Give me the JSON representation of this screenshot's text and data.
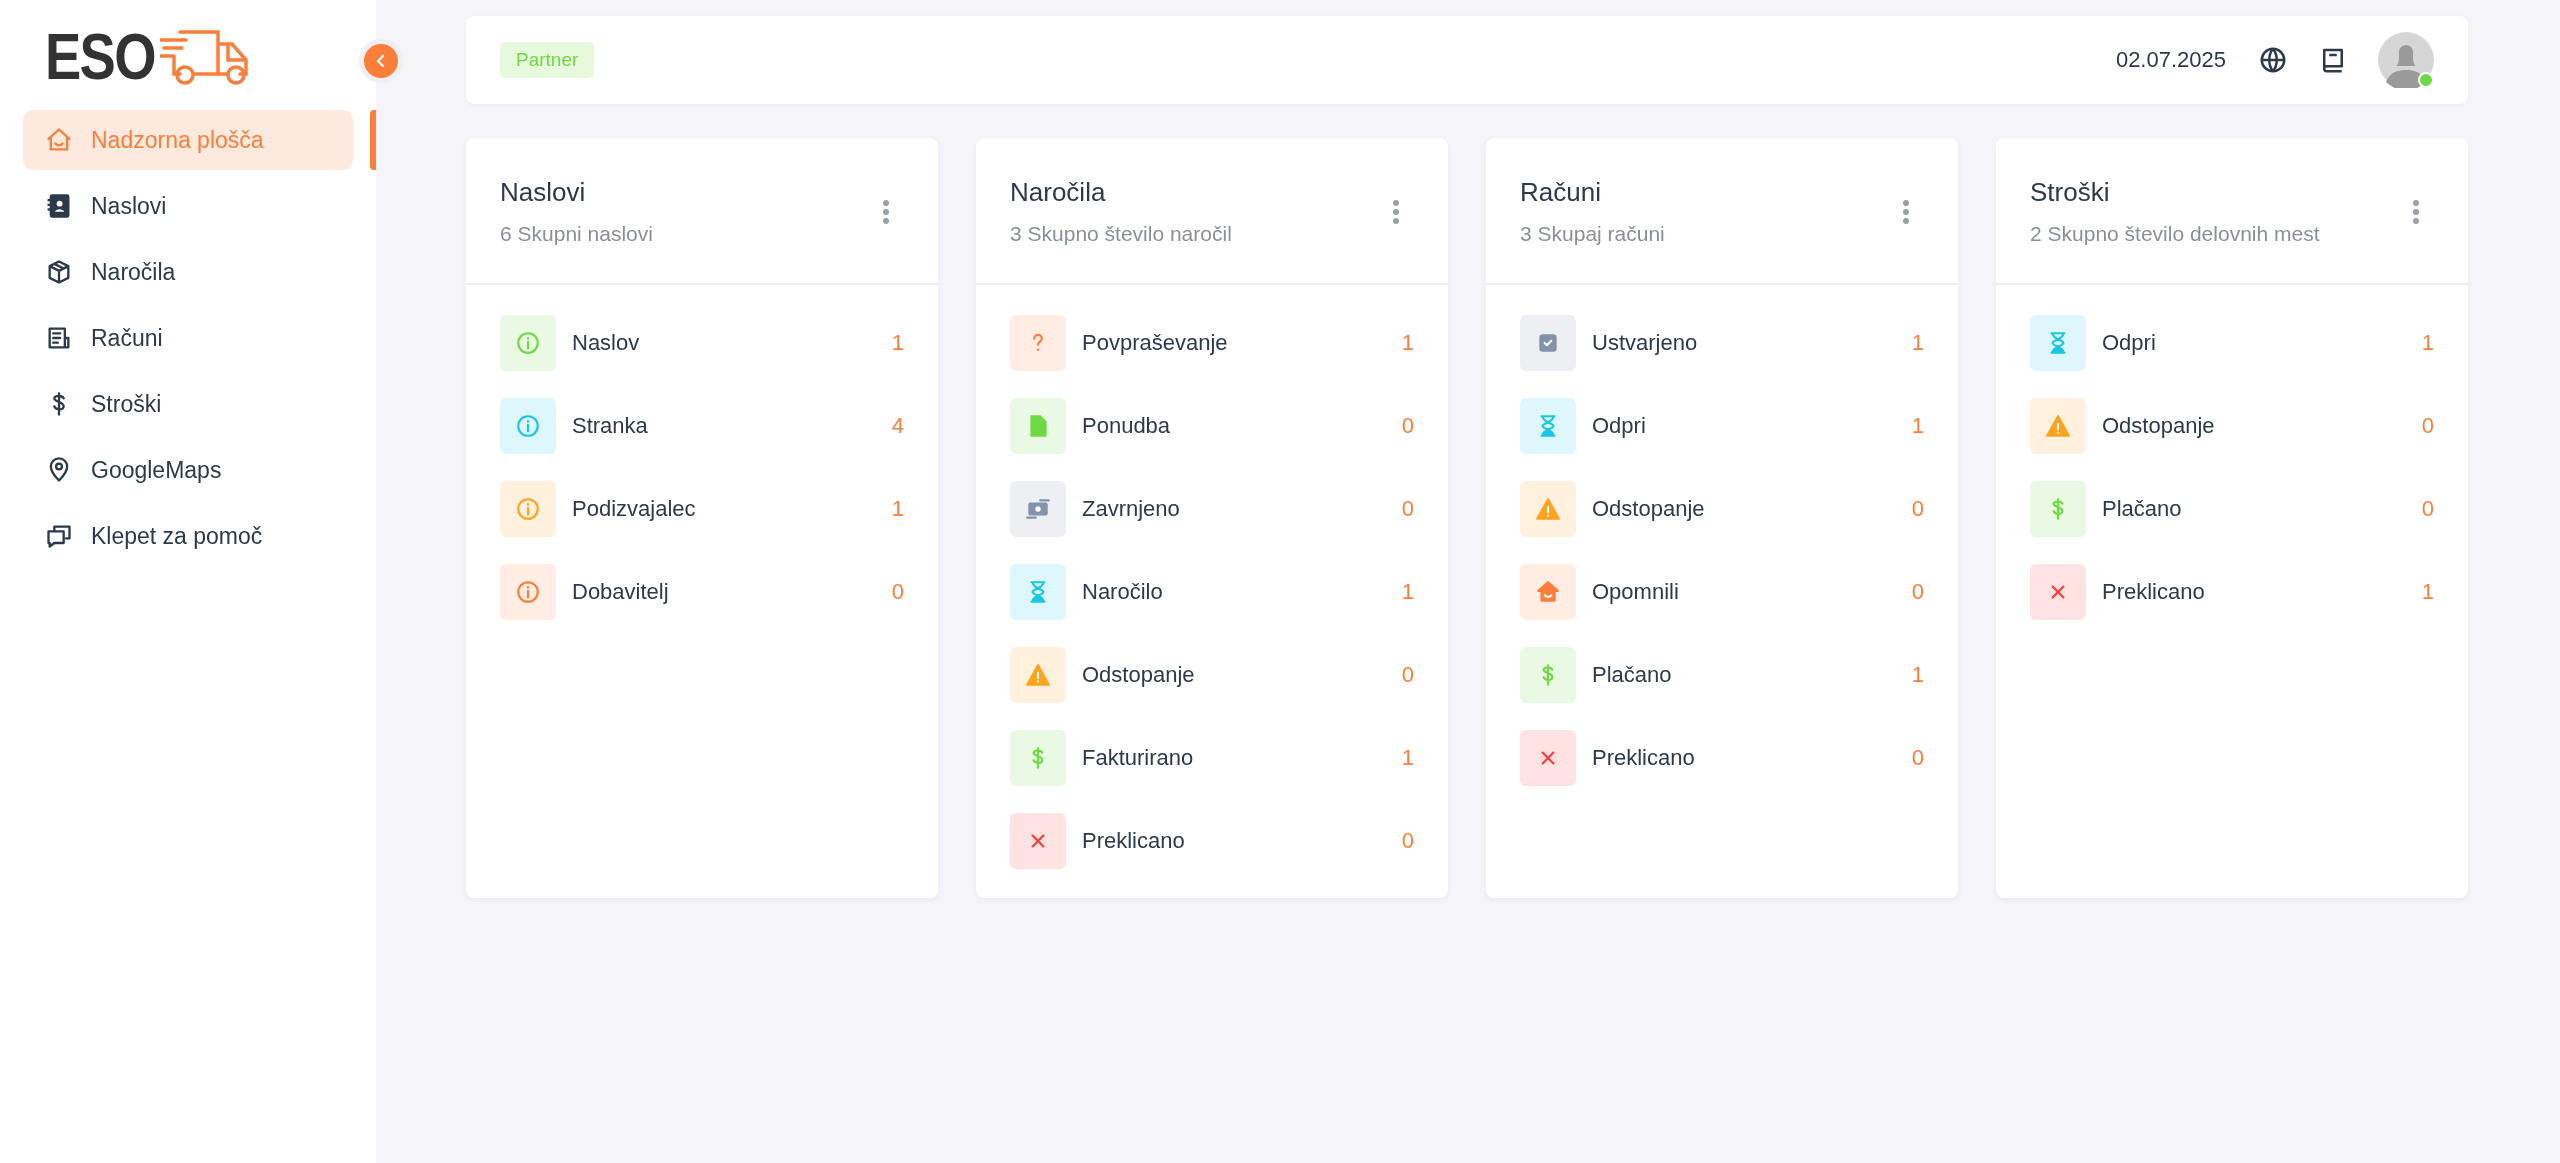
{
  "logo": {
    "text": "ESO"
  },
  "sidebar": {
    "items": [
      {
        "label": "Nadzorna plošča",
        "kind": "home",
        "selected": true
      },
      {
        "label": "Naslovi",
        "kind": "contacts",
        "selected": false
      },
      {
        "label": "Naročila",
        "kind": "box",
        "selected": false
      },
      {
        "label": "Računi",
        "kind": "invoice",
        "selected": false
      },
      {
        "label": "Stroški",
        "kind": "dollar",
        "selected": false
      },
      {
        "label": "GoogleMaps",
        "kind": "pin",
        "selected": false
      },
      {
        "label": "Klepet za pomoč",
        "kind": "chat",
        "selected": false
      }
    ]
  },
  "topbar": {
    "badge": "Partner",
    "date": "02.07.2025",
    "user_online": true
  },
  "cards": [
    {
      "title": "Naslovi",
      "subtitle": "6 Skupni naslovi",
      "rows": [
        {
          "label": "Naslov",
          "count": "1",
          "kind": "info",
          "color": "#6fd943"
        },
        {
          "label": "Stranka",
          "count": "4",
          "kind": "info",
          "color": "#18c6e8"
        },
        {
          "label": "Podizvajalec",
          "count": "1",
          "kind": "info",
          "color": "#ffa21d"
        },
        {
          "label": "Dobavitelj",
          "count": "0",
          "kind": "info",
          "color": "#fd7e3a"
        }
      ]
    },
    {
      "title": "Naročila",
      "subtitle": "3 Skupno število naročil",
      "rows": [
        {
          "label": "Povpraševanje",
          "count": "1",
          "kind": "question",
          "color": "#fd7e3a"
        },
        {
          "label": "Ponudba",
          "count": "0",
          "kind": "file",
          "color": "#6fd943"
        },
        {
          "label": "Zavrnjeno",
          "count": "0",
          "kind": "money",
          "color": "#8392ab"
        },
        {
          "label": "Naročilo",
          "count": "1",
          "kind": "hourglass",
          "color": "#18c6e8"
        },
        {
          "label": "Odstopanje",
          "count": "0",
          "kind": "warning",
          "color": "#ffa21d"
        },
        {
          "label": "Fakturirano",
          "count": "1",
          "kind": "dollar",
          "color": "#6fd943"
        },
        {
          "label": "Preklicano",
          "count": "0",
          "kind": "cross",
          "color": "#ff3a3a"
        }
      ]
    },
    {
      "title": "Računi",
      "subtitle": "3 Skupaj računi",
      "rows": [
        {
          "label": "Ustvarjeno",
          "count": "1",
          "kind": "check",
          "color": "#8392ab"
        },
        {
          "label": "Odpri",
          "count": "1",
          "kind": "hourglass",
          "color": "#18c6e8"
        },
        {
          "label": "Odstopanje",
          "count": "0",
          "kind": "warning",
          "color": "#ffa21d"
        },
        {
          "label": "Opomnili",
          "count": "0",
          "kind": "home",
          "color": "#fd7e3a"
        },
        {
          "label": "Plačano",
          "count": "1",
          "kind": "dollar",
          "color": "#6fd943"
        },
        {
          "label": "Preklicano",
          "count": "0",
          "kind": "cross",
          "color": "#ff3a3a"
        }
      ]
    },
    {
      "title": "Stroški",
      "subtitle": "2 Skupno število delovnih mest",
      "rows": [
        {
          "label": "Odpri",
          "count": "1",
          "kind": "hourglass",
          "color": "#18c6e8"
        },
        {
          "label": "Odstopanje",
          "count": "0",
          "kind": "warning",
          "color": "#ffa21d"
        },
        {
          "label": "Plačano",
          "count": "0",
          "kind": "dollar",
          "color": "#6fd943"
        },
        {
          "label": "Preklicano",
          "count": "1",
          "kind": "cross",
          "color": "#ff3a3a"
        }
      ]
    }
  ]
}
